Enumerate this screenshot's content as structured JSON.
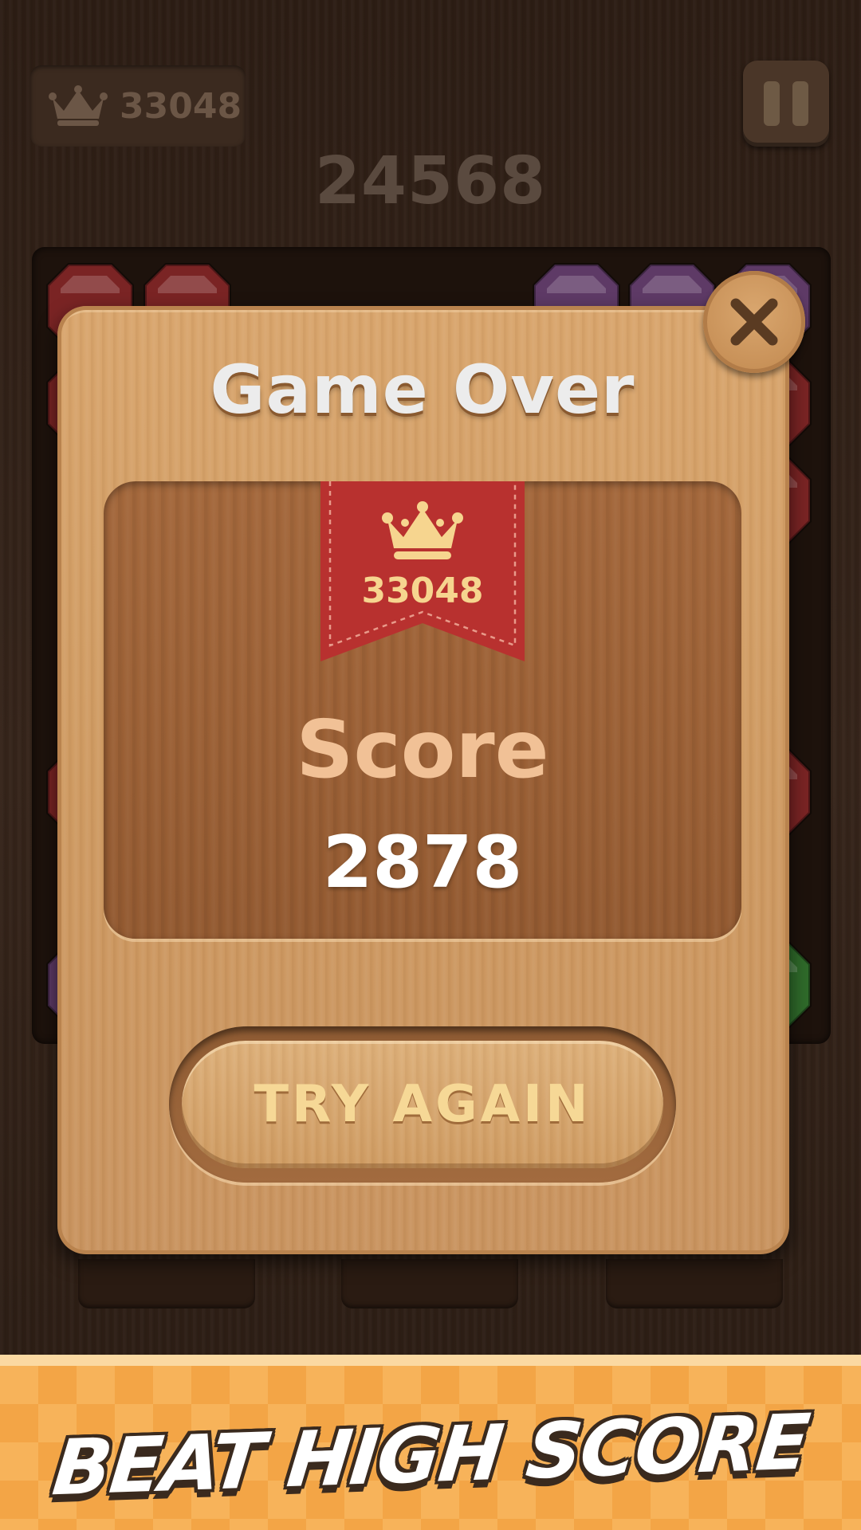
{
  "header": {
    "best_score": "33048",
    "current_score": "24568",
    "pause_icon": "pause-icon",
    "crown_icon": "crown-icon"
  },
  "dialog": {
    "title": "Game Over",
    "close_icon": "close-icon",
    "best_badge": {
      "icon": "crown-icon",
      "value": "33048",
      "color": "#b8312f"
    },
    "score_label": "Score",
    "score_value": "2878",
    "primary_button": "TRY AGAIN"
  },
  "banner": {
    "text": "BEAT HIGH SCORE",
    "color": "#f3a546"
  },
  "colors": {
    "board_bg": "#1d120c",
    "wood_light": "#d9a66e",
    "wood_dark": "#9c6136",
    "gem_red": "#7a2424",
    "gem_purple": "#5e3a66",
    "gem_green": "#2f6a2a"
  }
}
